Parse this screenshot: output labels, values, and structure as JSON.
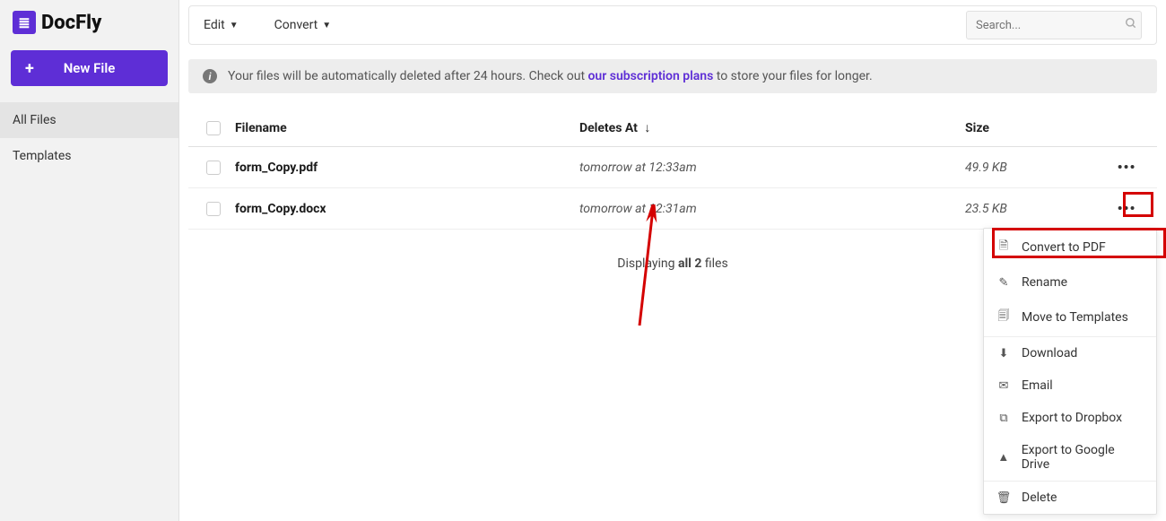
{
  "brand": {
    "name": "DocFly"
  },
  "sidebar": {
    "new_file": "New File",
    "items": [
      "All Files",
      "Templates"
    ]
  },
  "toolbar": {
    "edit": "Edit",
    "convert": "Convert",
    "search_placeholder": "Search..."
  },
  "banner": {
    "prefix": "Your files will be automatically deleted after 24 hours. Check out ",
    "link": "our subscription plans",
    "suffix": " to store your files for longer."
  },
  "table": {
    "headers": {
      "filename": "Filename",
      "deletes": "Deletes At",
      "size": "Size"
    },
    "rows": [
      {
        "name": "form_Copy.pdf",
        "deletes": "tomorrow at 12:33am",
        "size": "49.9 KB"
      },
      {
        "name": "form_Copy.docx",
        "deletes": "tomorrow at 12:31am",
        "size": "23.5 KB"
      }
    ]
  },
  "footer": {
    "pre": "Displaying ",
    "bold": "all 2",
    "post": " files"
  },
  "menu": {
    "convert": "Convert to PDF",
    "rename": "Rename",
    "move": "Move to Templates",
    "download": "Download",
    "email": "Email",
    "dropbox": "Export to Dropbox",
    "gdrive": "Export to Google Drive",
    "delete": "Delete"
  }
}
